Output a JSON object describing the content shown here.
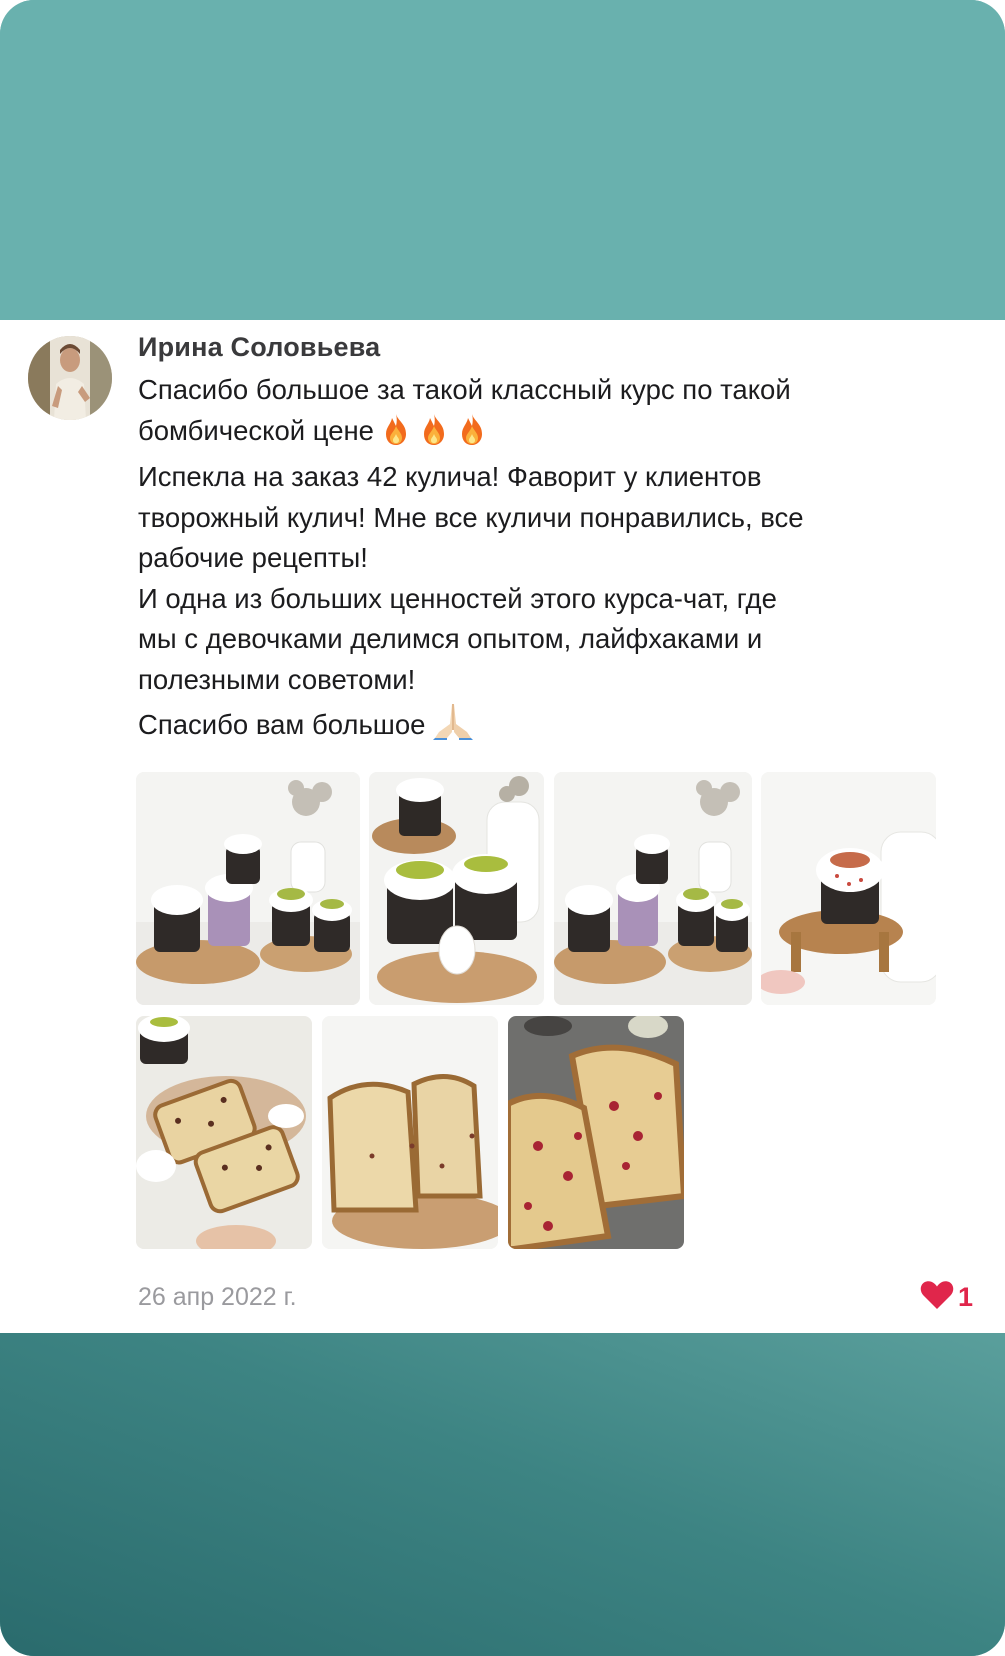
{
  "post": {
    "author": "Ирина Соловьева",
    "lines": [
      "Спасибо большое за такой классный курс по такой",
      "бомбической цене",
      "Испекла на заказ 42 кулича! Фаворит у клиентов",
      "творожный кулич! Мне все куличи понравились, все",
      "рабочие рецепты!",
      "И одна из больших ценностей этого курса-чат, где",
      "мы с девочками делимся опытом, лайфхаками и",
      "полезными советоми!",
      "Спасибо вам большое"
    ],
    "emojis": {
      "fire": "fire-icon",
      "pray": "praying-hands-icon"
    },
    "date": "26 апр 2022 г.",
    "likes": "1",
    "photos": [
      "kulich-set-photo",
      "kulich-pair-photo",
      "kulich-set-photo-repeat",
      "single-kulich-photo",
      "sliced-kulich-in-hand-photo",
      "sliced-kulich-photo",
      "kulich-slice-closeup-photo"
    ]
  },
  "colors": {
    "top_band": "#69b1ae",
    "bottom_band": "#2a6b6d",
    "like": "#e0264b",
    "text": "#1c1c1e",
    "meta": "#9a9a9e"
  }
}
